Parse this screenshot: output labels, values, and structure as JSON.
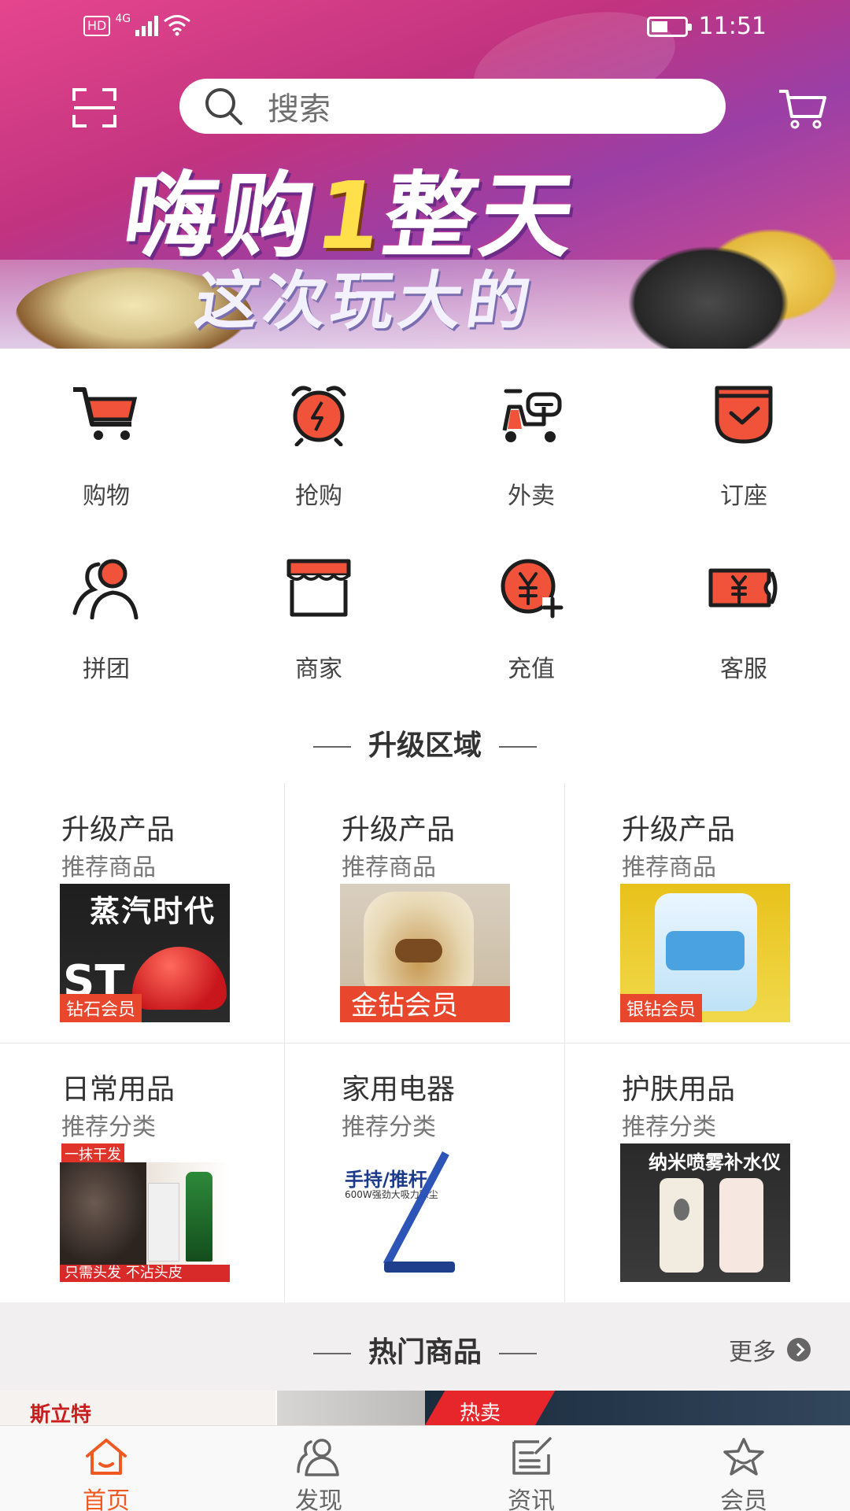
{
  "status_bar": {
    "hd_label": "HD",
    "network": "4G",
    "time": "11:51"
  },
  "banner": {
    "headline_part1": "嗨购",
    "headline_accent": "1",
    "headline_part2": "整天",
    "subline": "这次玩大的"
  },
  "top_bar": {
    "search_placeholder": "搜索"
  },
  "quick_entries": [
    {
      "label": "购物",
      "icon": "shopping-cart-icon"
    },
    {
      "label": "抢购",
      "icon": "alarm-clock-icon"
    },
    {
      "label": "外卖",
      "icon": "delivery-scooter-icon"
    },
    {
      "label": "订座",
      "icon": "check-box-icon"
    },
    {
      "label": "拼团",
      "icon": "group-users-icon"
    },
    {
      "label": "商家",
      "icon": "storefront-icon"
    },
    {
      "label": "充值",
      "icon": "yuan-coin-plus-icon"
    },
    {
      "label": "客服",
      "icon": "yuan-ticket-icon"
    }
  ],
  "upgrade_section": {
    "title": "升级区域",
    "cards": [
      {
        "title": "升级产品",
        "subtitle": "推荐商品",
        "image_text_top": "蒸汽时代",
        "image_text_mid": "ST",
        "tag": "钻石会员"
      },
      {
        "title": "升级产品",
        "subtitle": "推荐商品",
        "tag": "金钻会员"
      },
      {
        "title": "升级产品",
        "subtitle": "推荐商品",
        "tag": "银钻会员"
      },
      {
        "title": "日常用品",
        "subtitle": "推荐分类",
        "image_text_top": "一抹干发",
        "image_text_bottom": "只需头发 不沾头皮"
      },
      {
        "title": "家用电器",
        "subtitle": "推荐分类",
        "image_text_top": "手持/推杆",
        "image_text_mid": "600W强劲大吸力除尘"
      },
      {
        "title": "护肤用品",
        "subtitle": "推荐分类",
        "image_text_top": "纳米喷雾补水仪"
      }
    ]
  },
  "hot_section": {
    "title": "热门商品",
    "more_label": "更多",
    "strip_logo": "斯立特",
    "strip_badge": "热卖"
  },
  "tab_bar": {
    "tabs": [
      {
        "label": "首页",
        "icon": "home-icon",
        "active": true
      },
      {
        "label": "发现",
        "icon": "discover-icon",
        "active": false
      },
      {
        "label": "资讯",
        "icon": "news-icon",
        "active": false
      },
      {
        "label": "会员",
        "icon": "star-icon",
        "active": false
      }
    ]
  },
  "colors": {
    "accent": "#f05a22",
    "icon_red": "#f0533a",
    "icon_dark": "#1d1d1d"
  }
}
